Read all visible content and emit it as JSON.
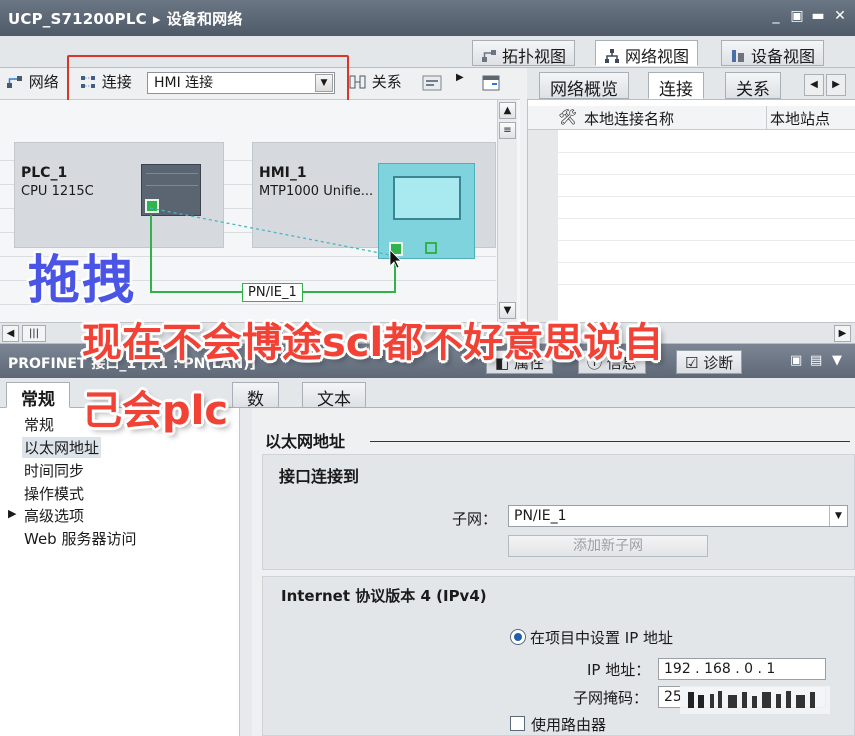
{
  "titlebar": {
    "project": "UCP_S71200PLC",
    "separator": "▸",
    "page": "设备和网络",
    "controls": [
      "_",
      "▣",
      "✕"
    ]
  },
  "view_tabs": [
    {
      "label": "拓扑视图",
      "icon": "topology-icon",
      "active": false
    },
    {
      "label": "网络视图",
      "icon": "network-icon",
      "active": true
    },
    {
      "label": "设备视图",
      "icon": "device-icon",
      "active": false
    }
  ],
  "toolbar": {
    "network_label": "网络",
    "connection_label": "连接",
    "connection_type": "HMI 连接",
    "relation_label": "关系"
  },
  "devices": {
    "plc": {
      "name": "PLC_1",
      "type": "CPU 1215C"
    },
    "hmi": {
      "name": "HMI_1",
      "type": "MTP1000  Unifie..."
    }
  },
  "subnet_label": "PN/IE_1",
  "right_panel": {
    "tabs": [
      {
        "label": "网络概览",
        "active": false
      },
      {
        "label": "连接",
        "active": true
      },
      {
        "label": "关系",
        "active": false
      }
    ],
    "columns": [
      "本地连接名称",
      "本地站点"
    ]
  },
  "inspector": {
    "title": "PROFINET 接口_1 [X1 : PN(LAN)]",
    "tabs": [
      "属性",
      "信息",
      "诊断"
    ]
  },
  "lower_tabs": [
    {
      "label": "常规",
      "active": true
    },
    {
      "label": "数",
      "active": false
    },
    {
      "label": "文本",
      "active": false
    }
  ],
  "nav_items": [
    {
      "label": "常规",
      "selected": false,
      "expandable": false
    },
    {
      "label": "以太网地址",
      "selected": true,
      "expandable": false
    },
    {
      "label": "时间同步",
      "selected": false,
      "expandable": false
    },
    {
      "label": "操作模式",
      "selected": false,
      "expandable": false
    },
    {
      "label": "高级选项",
      "selected": false,
      "expandable": true
    },
    {
      "label": "Web 服务器访问",
      "selected": false,
      "expandable": false
    }
  ],
  "ethernet": {
    "section_title": "以太网地址",
    "interface_title": "接口连接到",
    "subnet_label": "子网：",
    "subnet_value": "PN/IE_1",
    "add_subnet_button": "添加新子网",
    "ipv4_title": "Internet 协议版本 4 (IPv4)",
    "set_ip_option": "在项目中设置 IP 地址",
    "ip_label": "IP 地址：",
    "ip_value": "192 . 168 . 0    . 1",
    "mask_label": "子网掩码：",
    "mask_value": "25",
    "router_label": "使用路由器"
  },
  "overlay": {
    "drag_label": "拖拽",
    "caption_line1": "现在不会博途scl都不好意思说自",
    "caption_line2": "己会plc"
  },
  "colors": {
    "highlight_box": "#d7372b",
    "caption": "#f24236",
    "drag_label": "#4a55e6",
    "profinet_green": "#2fb34a",
    "hmi_device": "#7fd3dc"
  }
}
